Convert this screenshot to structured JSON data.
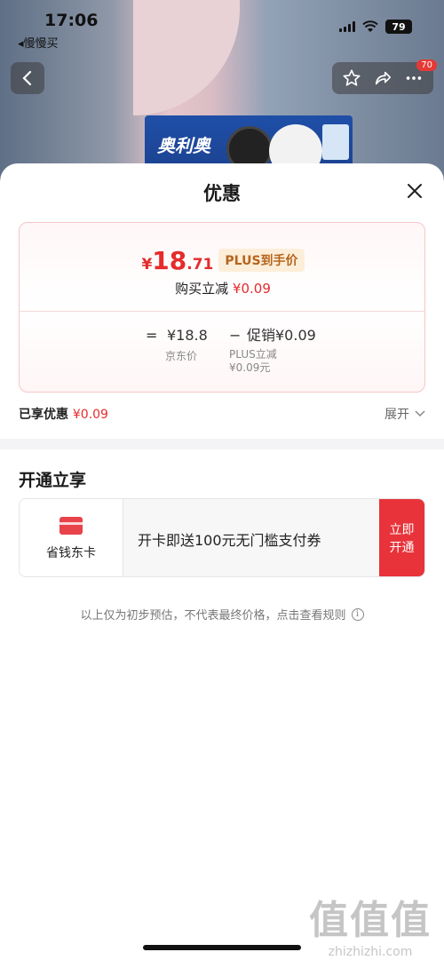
{
  "status_bar": {
    "time": "17:06",
    "back_app": "◂慢慢买",
    "battery": "79"
  },
  "nav": {
    "cart_badge": "70"
  },
  "product_image": {
    "brand_text": "奥利奥"
  },
  "sheet": {
    "title": "优惠",
    "price": {
      "currency": "¥",
      "integer": "18",
      "decimal": ".71",
      "tag": "PLUS到手价"
    },
    "instant_discount": {
      "label": "购买立减",
      "value": "¥0.09"
    },
    "formula": {
      "equals": "=",
      "base_price": "¥18.8",
      "minus": "−",
      "promo": "促销¥0.09",
      "base_label": "京东价",
      "promo_label_1": "PLUS立减",
      "promo_label_2": "¥0.09元"
    },
    "enjoyed": {
      "label": "已享优惠",
      "value": "¥0.09",
      "expand": "展开"
    },
    "open_section": {
      "title": "开通立享",
      "card_name": "省钱东卡",
      "offer": "开卡即送100元无门槛支付券",
      "button": "立即开通"
    },
    "disclaimer": "以上仅为初步预估，不代表最终价格，点击查看规则"
  },
  "watermark": {
    "big": "值值值",
    "small": "zhizhizhi.com"
  },
  "colors": {
    "accent_red": "#e52b2b",
    "plus_tag_bg": "#fdeed9",
    "plus_tag_text": "#b5651d"
  }
}
